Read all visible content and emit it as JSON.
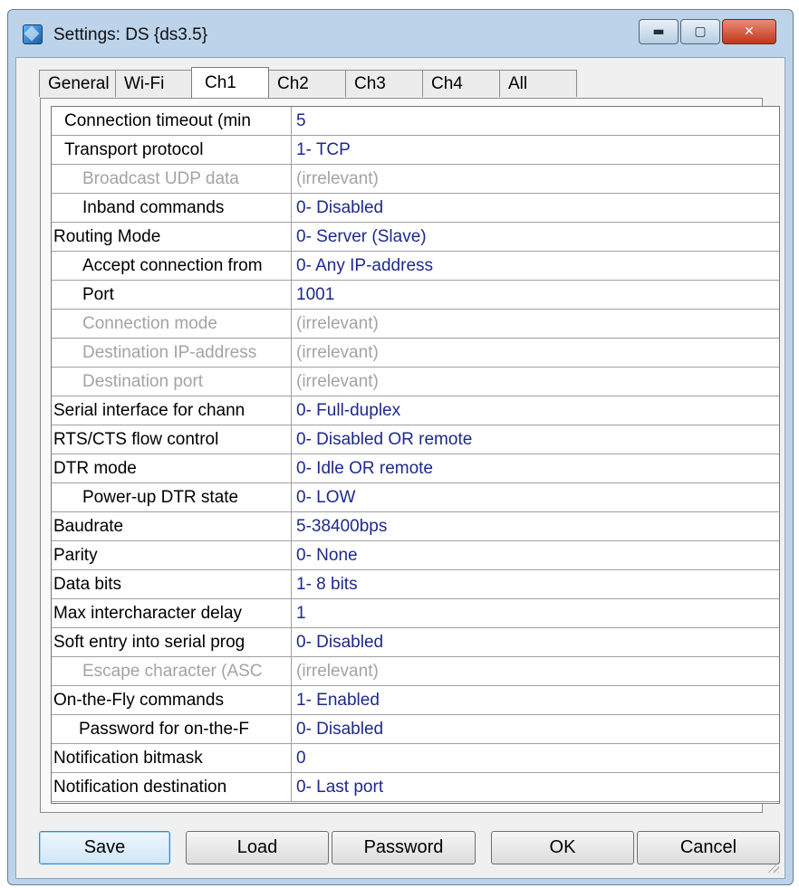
{
  "window": {
    "title": "Settings: DS {ds3.5}"
  },
  "title_buttons": {
    "minimize": "▬",
    "maximize": "▢",
    "close": "✕"
  },
  "tabs": [
    {
      "label": "General"
    },
    {
      "label": "Wi-Fi"
    },
    {
      "label": "Ch1",
      "selected": true
    },
    {
      "label": "Ch2"
    },
    {
      "label": "Ch3"
    },
    {
      "label": "Ch4"
    },
    {
      "label": "All"
    }
  ],
  "settings": [
    {
      "name": "Connection timeout (min",
      "value": "5",
      "disabled": false
    },
    {
      "name": "Transport protocol",
      "value": "1- TCP",
      "disabled": false
    },
    {
      "name": "Broadcast UDP data",
      "value": "(irrelevant)",
      "disabled": true
    },
    {
      "name": "Inband commands",
      "value": "0- Disabled",
      "disabled": false
    },
    {
      "name": "Routing Mode",
      "value": "0- Server (Slave)",
      "disabled": false
    },
    {
      "name": "Accept connection from",
      "value": "0- Any IP-address",
      "disabled": false
    },
    {
      "name": "Port",
      "value": "1001",
      "disabled": false
    },
    {
      "name": "Connection mode",
      "value": "(irrelevant)",
      "disabled": true
    },
    {
      "name": "Destination IP-address",
      "value": "(irrelevant)",
      "disabled": true
    },
    {
      "name": "Destination port",
      "value": "(irrelevant)",
      "disabled": true
    },
    {
      "name": "Serial interface for chann",
      "value": "0- Full-duplex",
      "disabled": false
    },
    {
      "name": "RTS/CTS flow control",
      "value": "0- Disabled OR remote",
      "disabled": false
    },
    {
      "name": "DTR mode",
      "value": "0- Idle OR remote",
      "disabled": false
    },
    {
      "name": "Power-up DTR state",
      "value": "0- LOW",
      "disabled": false
    },
    {
      "name": "Baudrate",
      "value": "5-38400bps",
      "disabled": false
    },
    {
      "name": "Parity",
      "value": "0- None",
      "disabled": false
    },
    {
      "name": "Data bits",
      "value": "1- 8 bits",
      "disabled": false
    },
    {
      "name": "Max intercharacter delay",
      "value": "1",
      "disabled": false
    },
    {
      "name": "Soft entry into serial prog",
      "value": "0- Disabled",
      "disabled": false
    },
    {
      "name": "Escape character (ASC",
      "value": "(irrelevant)",
      "disabled": true
    },
    {
      "name": "On-the-Fly commands",
      "value": "1- Enabled",
      "disabled": false
    },
    {
      "name": "Password for on-the-F",
      "value": "0- Disabled",
      "disabled": false
    },
    {
      "name": "Notification bitmask",
      "value": "0",
      "disabled": false
    },
    {
      "name": "Notification destination",
      "value": "0- Last port",
      "disabled": false
    }
  ],
  "buttons": {
    "save": "Save",
    "load": "Load",
    "password": "Password",
    "ok": "OK",
    "cancel": "Cancel"
  }
}
